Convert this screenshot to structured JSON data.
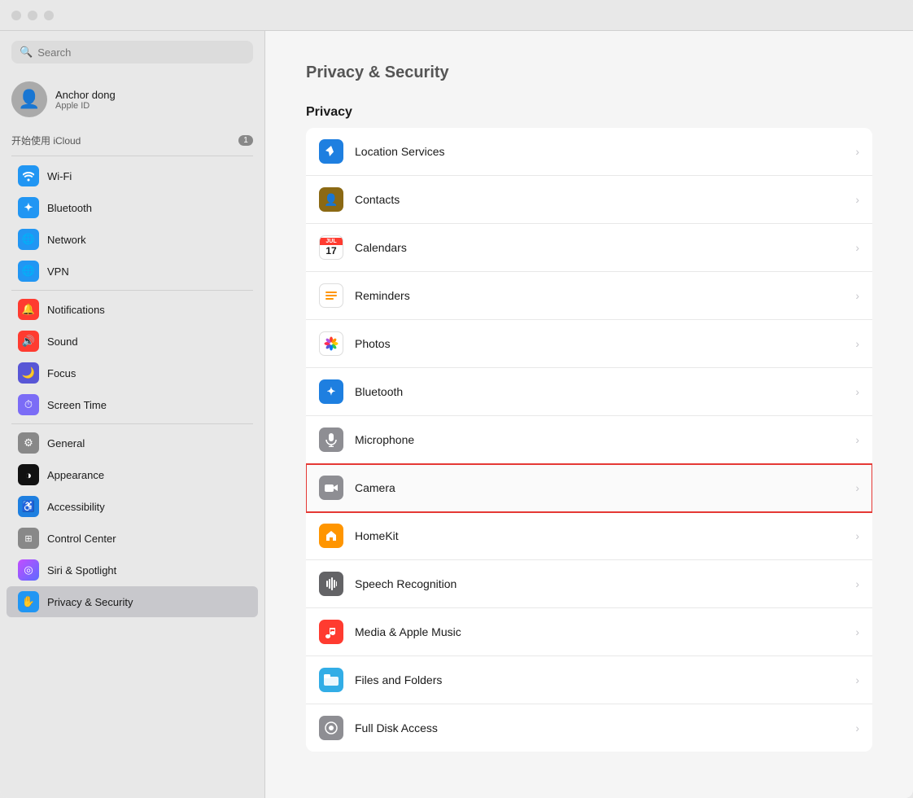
{
  "window": {
    "title": "Privacy & Security"
  },
  "trafficLights": [
    "close",
    "minimize",
    "maximize"
  ],
  "search": {
    "placeholder": "Search",
    "value": ""
  },
  "user": {
    "name": "Anchor dong",
    "subtitle": "Apple ID",
    "avatarSymbol": "👤"
  },
  "sidebar": {
    "icloudSection": {
      "label": "开始使用 iCloud",
      "badge": "1"
    },
    "items": [
      {
        "id": "wifi",
        "label": "Wi-Fi",
        "iconClass": "icon-wifi",
        "symbol": "📶"
      },
      {
        "id": "bluetooth",
        "label": "Bluetooth",
        "iconClass": "icon-bluetooth",
        "symbol": "❄"
      },
      {
        "id": "network",
        "label": "Network",
        "iconClass": "icon-network",
        "symbol": "🌐"
      },
      {
        "id": "vpn",
        "label": "VPN",
        "iconClass": "icon-vpn",
        "symbol": "🌐"
      },
      {
        "id": "notifications",
        "label": "Notifications",
        "iconClass": "icon-notifications",
        "symbol": "🔔"
      },
      {
        "id": "sound",
        "label": "Sound",
        "iconClass": "icon-sound",
        "symbol": "🔊"
      },
      {
        "id": "focus",
        "label": "Focus",
        "iconClass": "icon-focus",
        "symbol": "🌙"
      },
      {
        "id": "screentime",
        "label": "Screen Time",
        "iconClass": "icon-screentime",
        "symbol": "⏱"
      },
      {
        "id": "general",
        "label": "General",
        "iconClass": "icon-general",
        "symbol": "⚙"
      },
      {
        "id": "appearance",
        "label": "Appearance",
        "iconClass": "icon-appearance",
        "symbol": "◑"
      },
      {
        "id": "accessibility",
        "label": "Accessibility",
        "iconClass": "icon-accessibility",
        "symbol": "♿"
      },
      {
        "id": "controlcenter",
        "label": "Control Center",
        "iconClass": "icon-controlcenter",
        "symbol": "⊞"
      },
      {
        "id": "siri",
        "label": "Siri & Spotlight",
        "iconClass": "icon-siri",
        "symbol": "◎"
      },
      {
        "id": "privacy",
        "label": "Privacy & Security",
        "iconClass": "icon-privacy",
        "symbol": "✋",
        "active": true
      }
    ]
  },
  "content": {
    "title": "Privacy & Security",
    "sectionLabel": "Privacy",
    "rows": [
      {
        "id": "location",
        "label": "Location Services",
        "iconType": "blue",
        "symbol": "➤"
      },
      {
        "id": "contacts",
        "label": "Contacts",
        "iconType": "brown",
        "symbol": "👤"
      },
      {
        "id": "calendars",
        "label": "Calendars",
        "iconType": "calendar",
        "calMonth": "JUL",
        "calDate": "17"
      },
      {
        "id": "reminders",
        "label": "Reminders",
        "iconType": "reminders",
        "symbol": "≡"
      },
      {
        "id": "photos",
        "label": "Photos",
        "iconType": "photos",
        "symbol": "🌸"
      },
      {
        "id": "bluetooth",
        "label": "Bluetooth",
        "iconType": "blue",
        "symbol": "❄"
      },
      {
        "id": "microphone",
        "label": "Microphone",
        "iconType": "gray",
        "symbol": "🎤"
      },
      {
        "id": "camera",
        "label": "Camera",
        "iconType": "gray",
        "symbol": "📷",
        "highlighted": true
      },
      {
        "id": "homekit",
        "label": "HomeKit",
        "iconType": "orange",
        "symbol": "⌂"
      },
      {
        "id": "speech",
        "label": "Speech Recognition",
        "iconType": "darkgray",
        "symbol": "🎙"
      },
      {
        "id": "media",
        "label": "Media & Apple Music",
        "iconType": "red",
        "symbol": "♪"
      },
      {
        "id": "files",
        "label": "Files and Folders",
        "iconType": "cyan",
        "symbol": "📁"
      },
      {
        "id": "fulldisk",
        "label": "Full Disk Access",
        "iconType": "gray",
        "symbol": "💾"
      }
    ]
  }
}
